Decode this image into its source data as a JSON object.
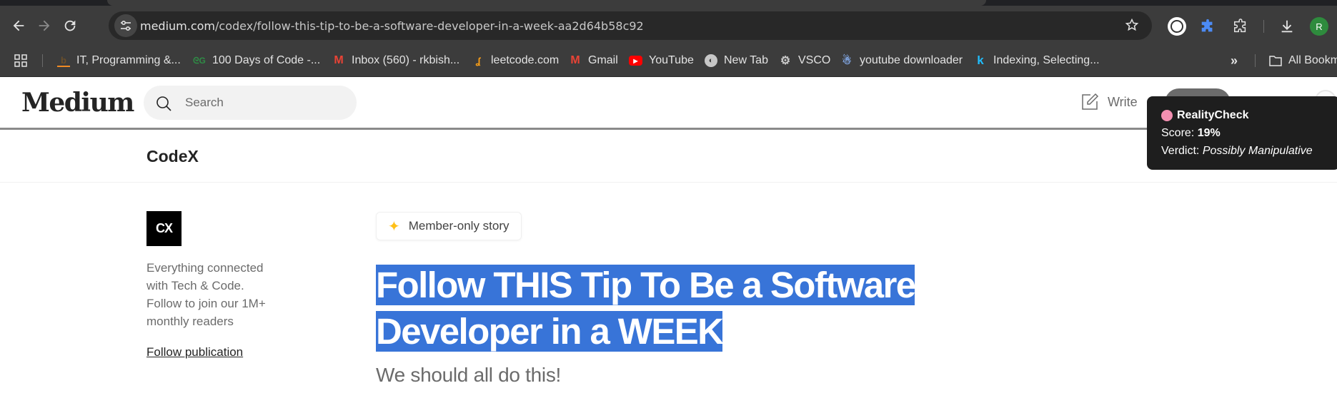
{
  "browser": {
    "url_host": "medium.com",
    "url_path": "/codex/follow-this-tip-to-be-a-software-developer-in-a-week-aa2d64b58c92",
    "profile_initial": "R",
    "bookmarks": [
      {
        "label": "IT, Programming &...",
        "icon": "bookmark-favicon-h"
      },
      {
        "label": "100 Days of Code -...",
        "icon": "geeksforgeeks-icon"
      },
      {
        "label": "Inbox (560) - rkbish...",
        "icon": "gmail-icon"
      },
      {
        "label": "leetcode.com",
        "icon": "leetcode-icon"
      },
      {
        "label": "Gmail",
        "icon": "gmail-icon"
      },
      {
        "label": "YouTube",
        "icon": "youtube-icon"
      },
      {
        "label": "New Tab",
        "icon": "globe-icon"
      },
      {
        "label": "VSCO",
        "icon": "vsco-icon"
      },
      {
        "label": "youtube downloader",
        "icon": "downloader-icon"
      },
      {
        "label": "Indexing, Selecting...",
        "icon": "kaggle-icon"
      }
    ],
    "all_bookmarks_label": "All Bookm"
  },
  "medium": {
    "logo": "Medium",
    "search_placeholder": "Search",
    "write_label": "Write"
  },
  "publication": {
    "name": "CodeX",
    "logo_text": "CX",
    "description": "Everything connected with Tech & Code. Follow to join our 1M+ monthly readers",
    "follow_label": "Follow publication"
  },
  "article": {
    "badge": "Member-only story",
    "title_line1": "Follow THIS Tip To Be a Software",
    "title_line2": "Developer in a WEEK",
    "subtitle": "We should all do this!"
  },
  "reality_check": {
    "title": "RealityCheck",
    "score_label": "Score:",
    "score_value": "19%",
    "verdict_label": "Verdict:",
    "verdict_value": "Possibly Manipulative"
  }
}
